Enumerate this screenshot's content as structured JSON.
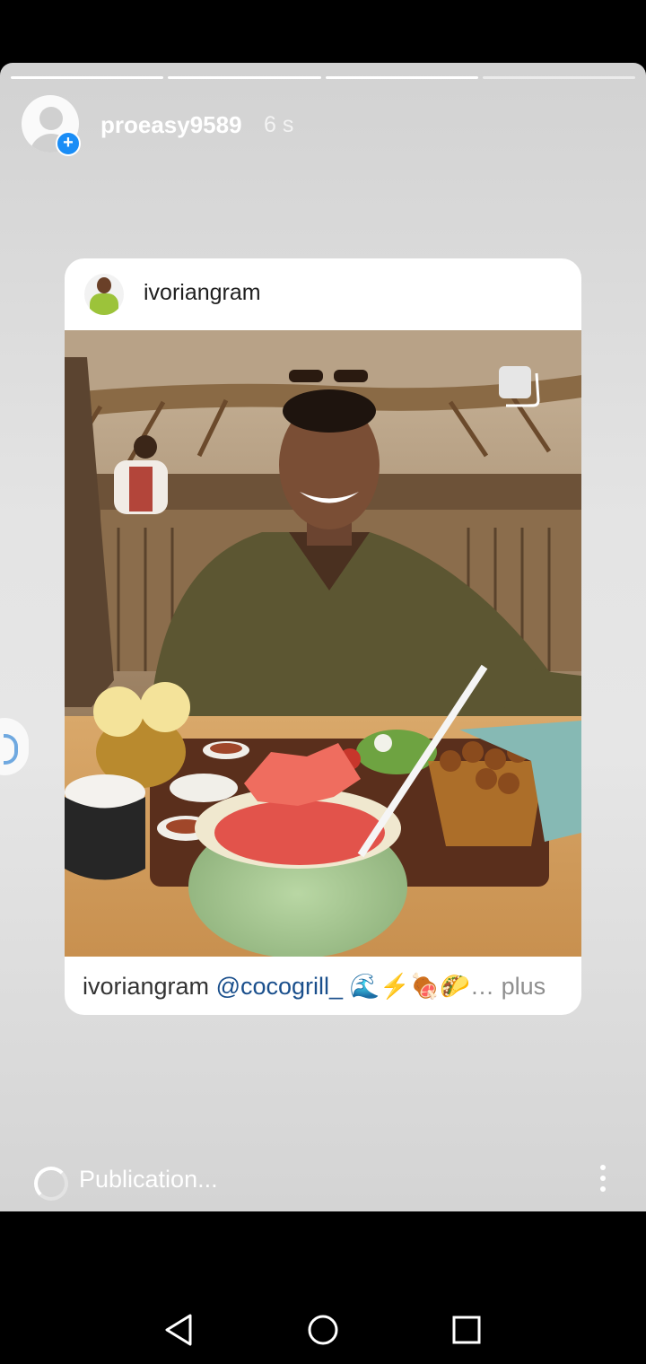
{
  "story": {
    "progress": {
      "segments": 4,
      "completed": 3
    },
    "username": "proeasy9589",
    "time": "6 s",
    "add_symbol": "+"
  },
  "card": {
    "username": "ivoriangram",
    "photo_description_icon": "multiple-photos-icon",
    "caption": {
      "user": "ivoriangram",
      "mention": "@cocogrill_",
      "emoji": "🌊⚡🍖🌮",
      "ellipsis": "…",
      "more": "plus"
    }
  },
  "status_bar": {
    "text": "Publication..."
  },
  "icons": {
    "avatar": "default-avatar-icon",
    "menu": "more-vertical-icon",
    "spinner": "loading-spinner-icon",
    "back": "nav-back-icon",
    "home": "nav-home-icon",
    "recent": "nav-recent-icon"
  },
  "colors": {
    "accent_blue": "#1a8df6",
    "mention": "#1a4f8c"
  }
}
